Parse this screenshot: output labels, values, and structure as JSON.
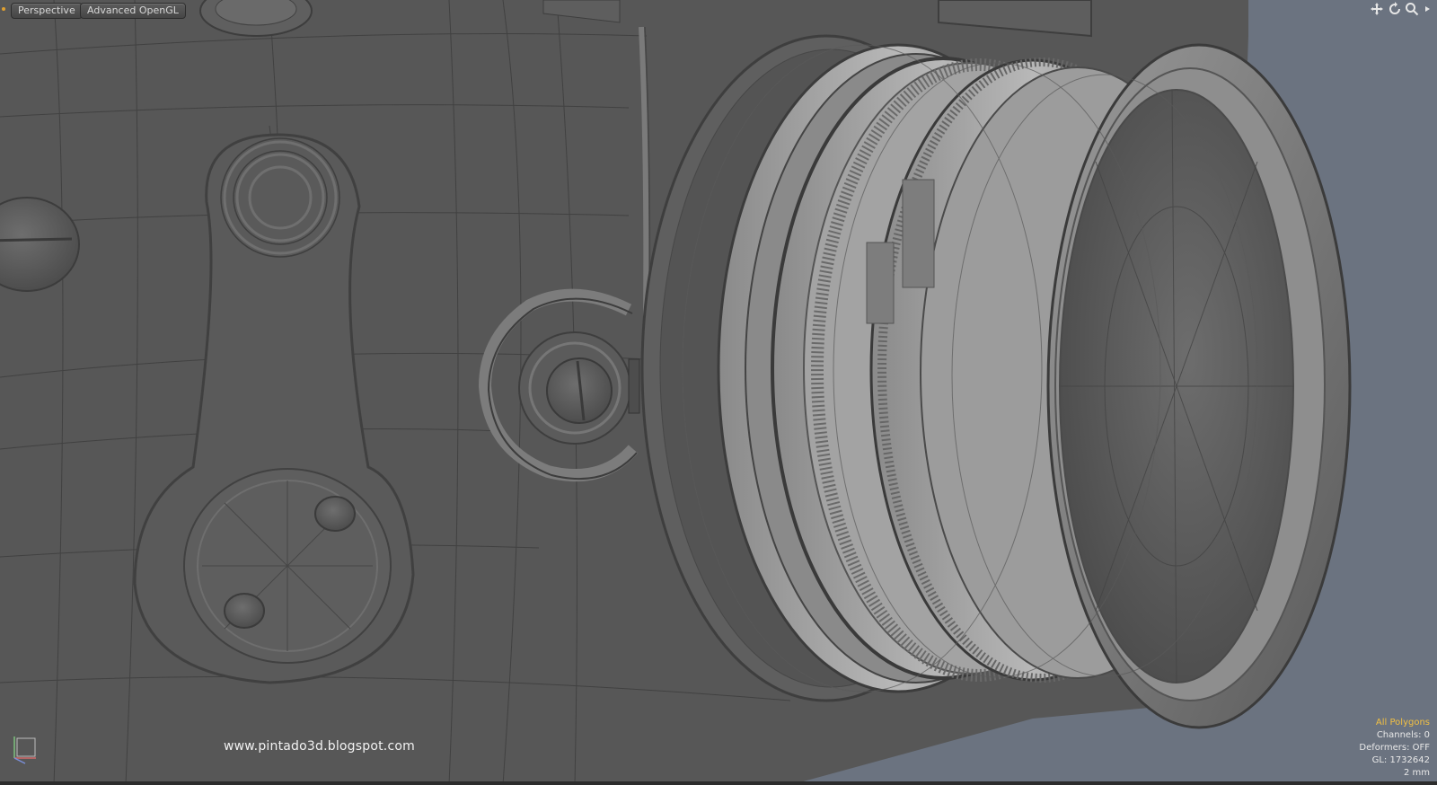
{
  "viewport": {
    "view_label": "Perspective",
    "shading_label": "Advanced OpenGL"
  },
  "nav_icons": [
    "move-view-icon",
    "rotate-view-icon",
    "zoom-view-icon",
    "viewport-menu-icon"
  ],
  "stats": {
    "selection": "All Polygons",
    "channels": "Channels: 0",
    "deformers": "Deformers: OFF",
    "gl": "GL: 1732642",
    "grid": "2 mm"
  },
  "watermark": "www.pintado3d.blogspot.com",
  "colors": {
    "background": "#6b7380",
    "body": "#575757",
    "highlight_text": "#f2c043",
    "accent_dot": "#e0a030"
  }
}
